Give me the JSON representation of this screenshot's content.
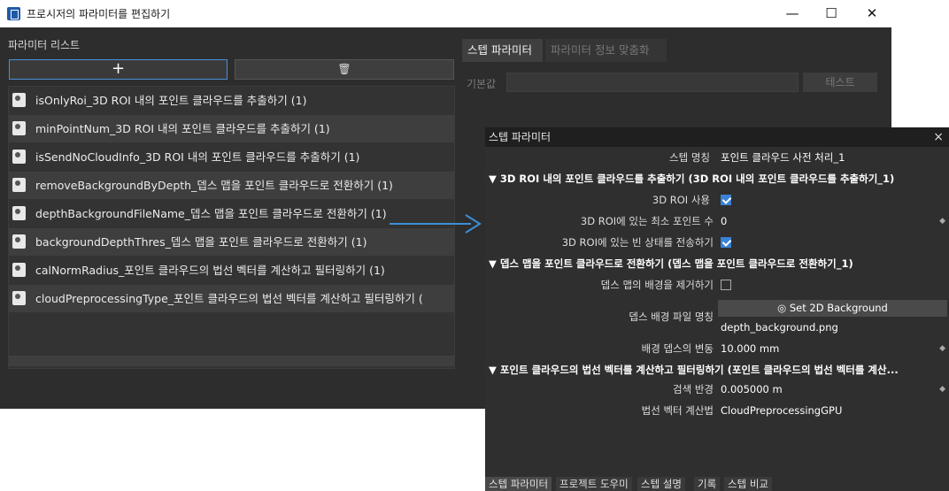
{
  "window": {
    "title": "프로시저의 파라미터를 편집하기",
    "controls": {
      "minimize": "—",
      "maximize": "☐",
      "close": "✕"
    }
  },
  "left": {
    "list_title": "파라미터 리스트",
    "add_label": "+",
    "delete_label": "🗑",
    "items": [
      "isOnlyRoi_3D ROI 내의 포인트 클라우드를 추출하기 (1)",
      "minPointNum_3D ROI 내의 포인트 클라우드를 추출하기 (1)",
      "isSendNoCloudInfo_3D ROI 내의 포인트 클라우드를 추출하기 (1)",
      "removeBackgroundByDepth_뎁스 맵을 포인트 클라우드로 전환하기 (1)",
      "depthBackgroundFileName_뎁스 맵을 포인트 클라우드로 전환하기 (1)",
      "backgroundDepthThres_뎁스 맵을 포인트 클라우드로 전환하기 (1)",
      "calNormRadius_포인트 클라우드의 법선 벡터를 계산하고 필터링하기 (1)",
      "cloudPreprocessingType_포인트 클라우드의 법선 벡터를 계산하고 필터링하기 ("
    ]
  },
  "right": {
    "tabs": [
      "스텝 파라미터",
      "파라미터 정보 맞춤화"
    ],
    "default_label": "기본값",
    "test_button": "테스트"
  },
  "step_panel": {
    "title": "스텝 파라미터",
    "close": "×",
    "step_name_label": "스텝 명칭",
    "step_name_value": "포인트 클라우드 사전 처리_1",
    "sections": [
      "▼  3D ROI 내의 포인트 클라우드를 추출하기 (3D ROI 내의 포인트 클라우드를 추출하기_1)",
      "▼  뎁스 맵을 포인트 클라우드로 전환하기 (뎁스 맵을 포인트 클라우드로 전환하기_1)",
      "▼  포인트 클라우드의 법선 벡터를 계산하고 필터링하기 (포인트 클라우드의 법선 벡터를 계산..."
    ],
    "roi_use_label": "3D ROI 사용",
    "roi_use_checked": true,
    "min_points_label": "3D ROI에 있는 최소 포인트 수",
    "min_points_value": "0",
    "send_empty_label": "3D ROI에 있는 빈 상태를 전송하기",
    "send_empty_checked": true,
    "remove_bg_label": "뎁스 맵의 배경을 제거하기",
    "remove_bg_checked": false,
    "bg_file_label": "뎁스 배경 파일 명칭",
    "bg_button": "◎ Set 2D Background",
    "bg_file_value": "depth_background.png",
    "bg_var_label": "배경 뎁스의 변동",
    "bg_var_value": "10.000 mm",
    "search_radius_label": "검색 반경",
    "search_radius_value": "0.005000 m",
    "normal_method_label": "법선 벡터 계산법",
    "normal_method_value": "CloudPreprocessingGPU",
    "spin_glyph": "◆",
    "bottom_tabs": [
      "스텝 파라미터",
      "프로젝트 도우미",
      "스텝 설명",
      "기록",
      "스텝 비교"
    ]
  },
  "colors": {
    "accent": "#3a82d6",
    "arrow": "#3c8fd6",
    "panel": "#2d2d2d"
  }
}
